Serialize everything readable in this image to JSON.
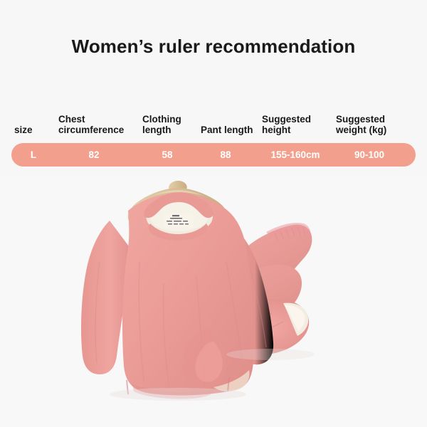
{
  "page": {
    "title": "Women’s ruler recommendation",
    "background_color": "#f7f7f7",
    "title_color": "#1a1a1a"
  },
  "size_table": {
    "row_color": "#f2a08d",
    "row_text_color": "#ffffff",
    "headers": [
      {
        "key": "size",
        "line1": "size",
        "line2": ""
      },
      {
        "key": "chest",
        "line1": "Chest",
        "line2": "circumference"
      },
      {
        "key": "cloth",
        "line1": "Clothing",
        "line2": "length"
      },
      {
        "key": "pant",
        "line1": "Pant length",
        "line2": ""
      },
      {
        "key": "height",
        "line1": "Suggested",
        "line2": "height"
      },
      {
        "key": "weight",
        "line1": "Suggested",
        "line2": "weight (kg)"
      }
    ],
    "rows": [
      {
        "size": "L",
        "chest": "82",
        "cloth": "58",
        "pant": "88",
        "height": "155-160cm",
        "weight": "90-100"
      }
    ]
  },
  "product_photo": {
    "description": "Women’s pink thermal underwear set: long-sleeve top on a wooden hanger beside folded matching pants",
    "garment_color": "#eb9c97",
    "garment_shadow_color": "#dd8b88",
    "lining_color": "#f2ece0",
    "hanger_color": "#d8bf98",
    "items": [
      {
        "name": "thermal-top",
        "label": "long sleeve top"
      },
      {
        "name": "thermal-pants",
        "label": "folded pants"
      },
      {
        "name": "wooden-hanger",
        "label": "wooden hanger"
      },
      {
        "name": "care-label",
        "label": "care label"
      }
    ]
  }
}
